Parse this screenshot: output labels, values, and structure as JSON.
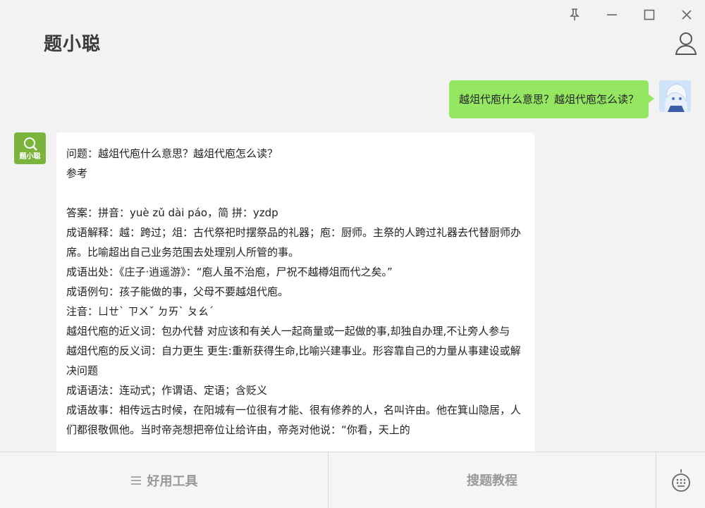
{
  "window": {
    "title": "题小聪",
    "controls": [
      "pin-icon",
      "minimize-icon",
      "maximize-icon",
      "close-icon"
    ]
  },
  "header": {
    "user_icon": "user-icon"
  },
  "chat": {
    "user_message": "越俎代庖什么意思？越俎代庖怎么读？",
    "bot_avatar_label": "题小聪",
    "answer_lines": [
      "问题：越俎代庖什么意思？越俎代庖怎么读？",
      "参考",
      "",
      "答案：拼音：yuè zǔ dài páo，简 拼：yzdp",
      "成语解释：越：跨过；俎：古代祭祀时摆祭品的礼器；庖：厨师。主祭的人跨过礼器去代替厨师办席。比喻超出自己业务范围去处理别人所管的事。",
      "成语出处：《庄子·逍遥游》：“庖人虽不治庖，尸祝不越樽俎而代之矣。”",
      "成语例句：孩子能做的事，父母不要越俎代庖。",
      "注音：ㄩㄝˋ ㄗㄨˇ ㄉㄞˋ ㄆㄠˊ",
      "越俎代庖的近义词：包办代替 对应该和有关人一起商量或一起做的事,却独自办理,不让旁人参与",
      "越俎代庖的反义词：自力更生 更生:重新获得生命,比喻兴建事业。形容靠自己的力量从事建设或解决问题",
      "成语语法：连动式；作谓语、定语；含贬义",
      "成语故事：相传远古时候，在阳城有一位很有才能、很有修养的人，名叫许由。他在箕山隐居，人们都很敬佩他。当时帝尧想把帝位让给许由，帝尧对他说：“你看，天上的"
    ]
  },
  "toolbar": {
    "tools_label": "好用工具",
    "tutorial_label": "搜题教程",
    "keyboard_icon": "keyboard-icon"
  },
  "colors": {
    "user_bubble": "#95e661",
    "bot_avatar": "#7ab43c",
    "background": "#f2f2f2"
  }
}
